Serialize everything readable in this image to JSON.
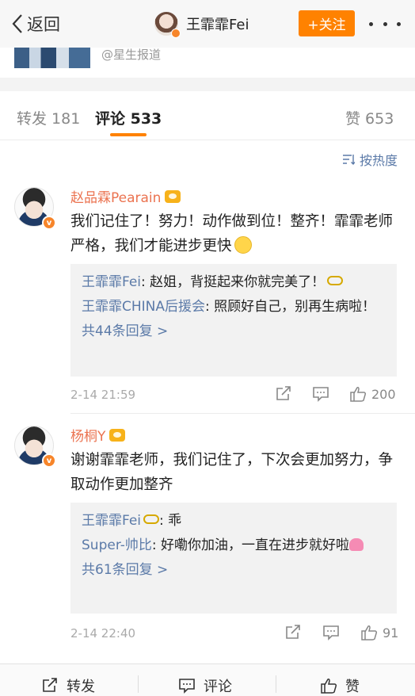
{
  "nav": {
    "back_label": "返回",
    "user_name": "王霏霏Fei",
    "follow_label": "+关注"
  },
  "source": {
    "text": "@星生报道"
  },
  "tabs": {
    "repost": "转发 181",
    "comment": "评论 533",
    "like": "赞 653"
  },
  "sort_label": "按热度",
  "comments": [
    {
      "name": "赵品霖Pearain",
      "text": "我们记住了！努力！动作做到位！整齐！霏霏老师严格，我们才能进步更快",
      "replies": [
        {
          "who": "王霏霏Fei",
          "text": ": 赵姐，背挺起来你就完美了！"
        },
        {
          "who": "王霏霏CHINA后援会",
          "text": ": 照顾好自己，别再生病啦！"
        }
      ],
      "more_replies": "共44条回复 >",
      "time": "2-14 21:59",
      "likes": "200"
    },
    {
      "name": "杨桐Y",
      "text": "谢谢霏霏老师，我们记住了，下次会更加努力，争取动作更加整齐",
      "replies": [
        {
          "who": "王霏霏Fei",
          "text": ": 乖"
        },
        {
          "who": "Super-帅比",
          "text": ": 好嘞你加油，一直在进步就好啦"
        }
      ],
      "more_replies": "共61条回复 >",
      "time": "2-14 22:40",
      "likes": "91"
    }
  ],
  "bottom_bar": {
    "repost": "转发",
    "comment": "评论",
    "like": "赞"
  },
  "colors": {
    "accent": "#ff8200",
    "link": "#5b7aa8",
    "username": "#eb7350"
  }
}
